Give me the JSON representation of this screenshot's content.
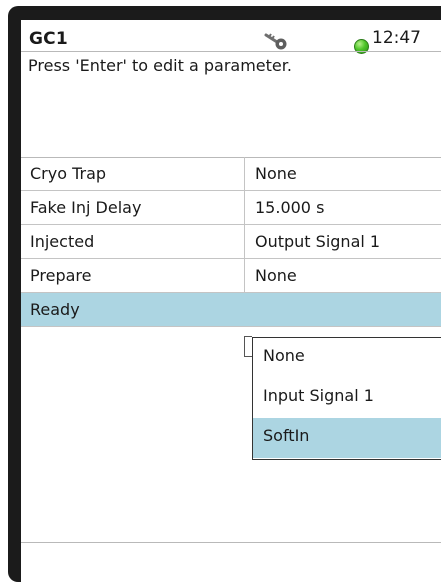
{
  "header": {
    "title": "GC1",
    "clock": "12:47",
    "status_color": "#4fc52a"
  },
  "message": "Press 'Enter' to edit a parameter.",
  "parameters": [
    {
      "name": "Cryo Trap",
      "value": "None"
    },
    {
      "name": "Fake Inj Delay",
      "value": "15.000 s"
    },
    {
      "name": "Injected",
      "value": "Output Signal 1"
    },
    {
      "name": "Prepare",
      "value": "None"
    },
    {
      "name": "Ready",
      "value": ""
    }
  ],
  "dropdown": {
    "options": [
      "None",
      "Input Signal 1",
      "SoftIn"
    ],
    "highlighted": "SoftIn"
  },
  "colors": {
    "selection": "#acd5e2",
    "bezel": "#1b1b1b"
  },
  "icons": [
    "key-icon",
    "status-indicator-icon"
  ]
}
